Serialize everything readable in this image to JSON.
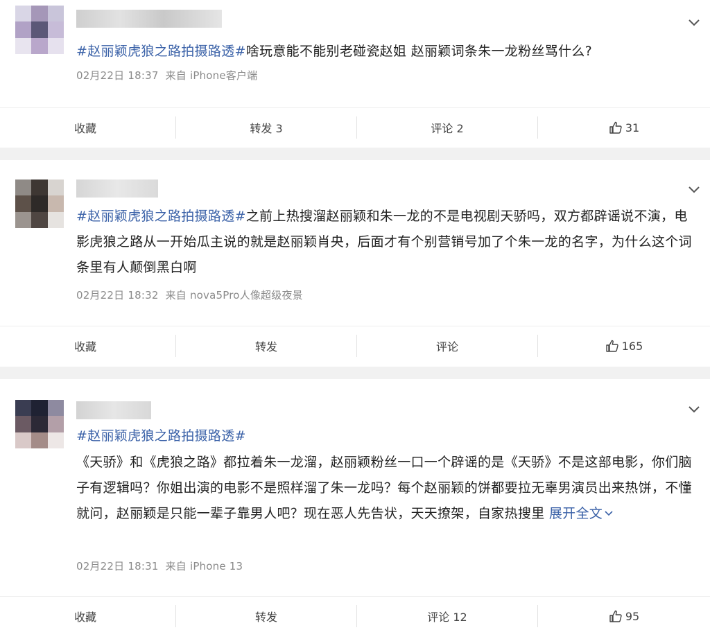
{
  "colors": {
    "link": "#3b62a8",
    "meta": "#8a8a8a",
    "text": "#222222"
  },
  "posts": [
    {
      "hashtag": "#赵丽颖虎狼之路拍摄路透#",
      "body": "啥玩意能不能别老碰瓷赵姐 赵丽颖词条朱一龙粉丝骂什么?",
      "date": "02月22日 18:37",
      "source": "来自 iPhone客户端",
      "actions": {
        "collect": "收藏",
        "repost": "转发 3",
        "comment": "评论 2",
        "likes": "31"
      }
    },
    {
      "hashtag": "#赵丽颖虎狼之路拍摄路透#",
      "body": "之前上热搜溜赵丽颖和朱一龙的不是电视剧天骄吗，双方都辟谣说不演，电影虎狼之路从一开始瓜主说的就是赵丽颖肖央，后面才有个别营销号加了个朱一龙的名字，为什么这个词条里有人颠倒黑白啊",
      "date": "02月22日 18:32",
      "source": "来自 nova5Pro人像超级夜景",
      "actions": {
        "collect": "收藏",
        "repost": "转发",
        "comment": "评论",
        "likes": "165"
      }
    },
    {
      "hashtag": "#赵丽颖虎狼之路拍摄路透#",
      "body": "《天骄》和《虎狼之路》都拉着朱一龙溜，赵丽颖粉丝一口一个辟谣的是《天骄》不是这部电影，你们脑子有逻辑吗？你姐出演的电影不是照样溜了朱一龙吗？每个赵丽颖的饼都要拉无辜男演员出来热饼，不懂就问，赵丽颖是只能一辈子靠男人吧？现在恶人先告状，天天撩架，自家热搜里 ",
      "expand": "展开全文",
      "date": "02月22日 18:31",
      "source": "来自 iPhone 13",
      "actions": {
        "collect": "收藏",
        "repost": "转发",
        "comment": "评论 12",
        "likes": "95"
      }
    }
  ]
}
